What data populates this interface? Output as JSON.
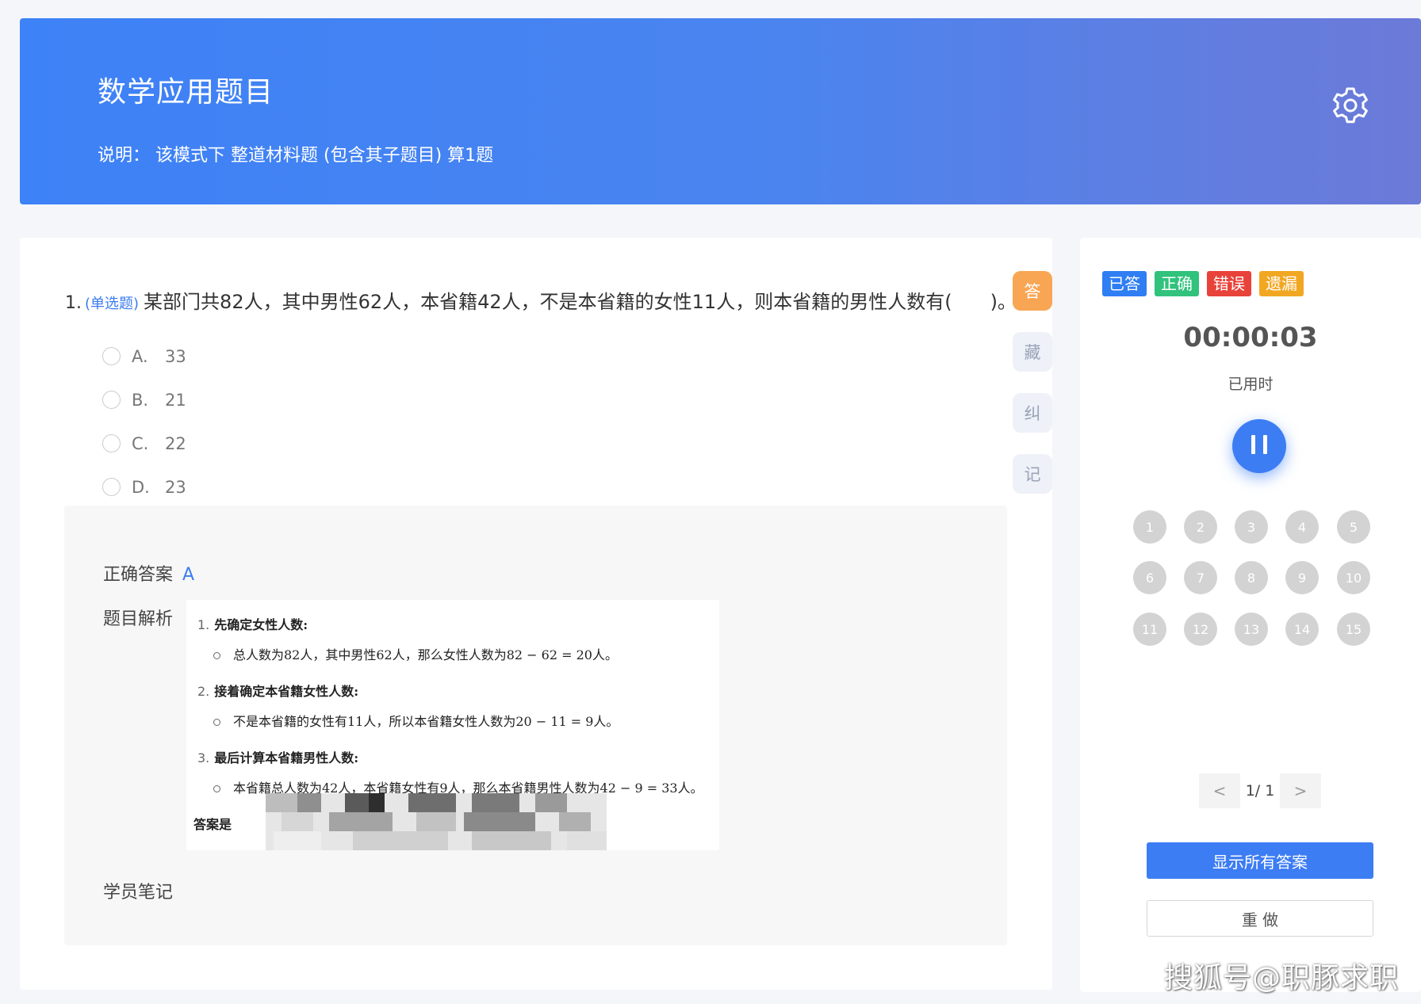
{
  "header": {
    "title": "数学应用题目",
    "description": "说明： 该模式下 整道材料题 (包含其子题目) 算1题",
    "settings_icon": "gear-icon"
  },
  "question": {
    "number": "1.",
    "type_tag": "(单选题)",
    "stem": "某部门共82人，其中男性62人，本省籍42人，不是本省籍的女性11人，则本省籍的男性人数有(　　)。",
    "options": [
      {
        "letter": "A.",
        "text": "33"
      },
      {
        "letter": "B.",
        "text": "21"
      },
      {
        "letter": "C.",
        "text": "22"
      },
      {
        "letter": "D.",
        "text": "23"
      }
    ]
  },
  "side_tools": [
    "答",
    "藏",
    "纠",
    "记"
  ],
  "answer": {
    "correct_label": "正确答案",
    "correct_value": "A",
    "analysis_label": "题目解析",
    "notes_label": "学员笔记",
    "analysis": {
      "s1_num": "1.",
      "s1_title": "先确定女性人数:",
      "s1_body": "总人数为82人，其中男性62人，那么女性人数为",
      "s1_math": "82 − 62 = 20人。",
      "s2_num": "2.",
      "s2_title": "接着确定本省籍女性人数:",
      "s2_body": "不是本省籍的女性有11人，所以本省籍女性人数为",
      "s2_math": "20 − 11 = 9人。",
      "s3_num": "3.",
      "s3_title": "最后计算本省籍男性人数:",
      "s3_body": "本省籍总人数为42人，本省籍女性有9人，那么本省籍男性人数为",
      "s3_math": "42 − 9 = 33人。",
      "conclusion": "答案是"
    }
  },
  "sidebar": {
    "legend": [
      {
        "label": "已答",
        "color": "#2f7ef3"
      },
      {
        "label": "正确",
        "color": "#31c27c"
      },
      {
        "label": "错误",
        "color": "#e8433a"
      },
      {
        "label": "遗漏",
        "color": "#f2a722"
      }
    ],
    "timer": "00:00:03",
    "timer_label": "已用时",
    "pause_icon": "pause-icon",
    "numbers": [
      "1",
      "2",
      "3",
      "4",
      "5",
      "6",
      "7",
      "8",
      "9",
      "10",
      "11",
      "12",
      "13",
      "14",
      "15"
    ],
    "pager": {
      "prev": "<",
      "text": "1/ 1",
      "next": ">"
    },
    "show_all_label": "显示所有答案",
    "redo_label": "重 做"
  },
  "watermark": "搜狐号@职豚求职"
}
